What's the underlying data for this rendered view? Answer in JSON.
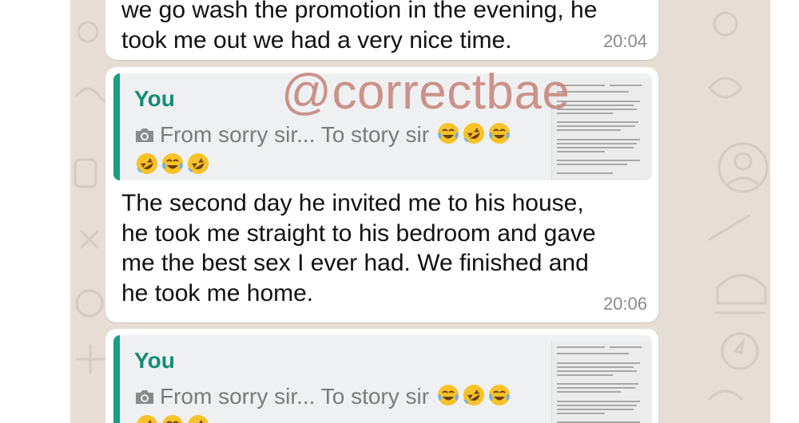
{
  "watermark": "@correctbae",
  "messages": [
    {
      "text": "we go wash the promotion in the evening, he\ntook me out we had a very nice time.",
      "time": "20:04"
    },
    {
      "quote": {
        "author": "You",
        "icon": "camera-icon",
        "text": "From sorry sir... To story sir"
      },
      "text": "The second day he invited me to his house,\nhe took me straight to his bedroom and gave\nme the best sex I ever had. We finished  and\nhe took me home.",
      "time": "20:06"
    },
    {
      "quote": {
        "author": "You",
        "icon": "camera-icon",
        "text": "From sorry sir... To story sir"
      }
    }
  ],
  "colors": {
    "chat_background": "#e6ddd4",
    "bubble": "#ffffff",
    "quote_bar": "#19a07e",
    "quote_author": "#138d73",
    "watermark": "#c8887e"
  }
}
